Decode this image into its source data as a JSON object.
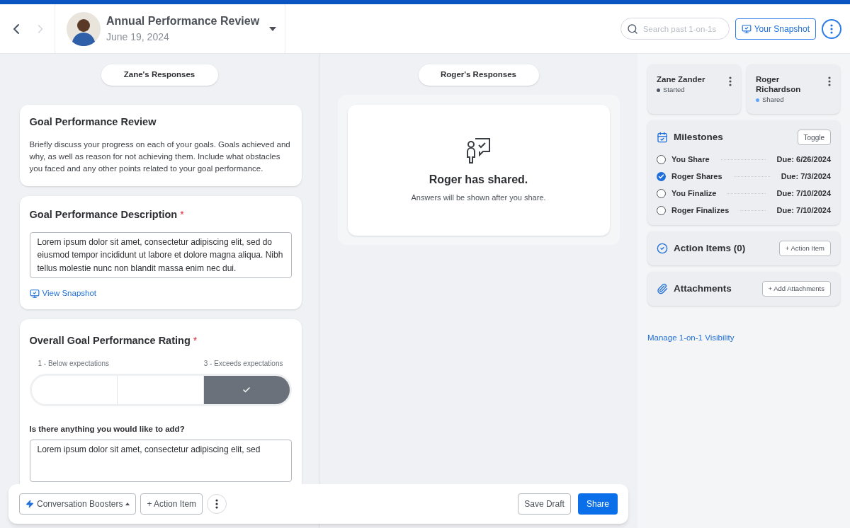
{
  "header": {
    "title": "Annual Performance Review",
    "date": "June 19, 2024",
    "search": {
      "placeholder": "Search past 1-on-1s"
    },
    "snapshot_button": "Your Snapshot"
  },
  "left": {
    "tab": "Zane's Responses",
    "intro": {
      "title": "Goal Performance Review",
      "text": "Briefly discuss your progress on each of your goals. Goals achieved and why, as well as reason for not achieving them. Include what obstacles you faced and any other points related to your goal performance."
    },
    "description": {
      "title": "Goal Performance Description",
      "required_mark": "*",
      "answer": "Lorem ipsum dolor sit amet, consectetur adipiscing elit, sed do eiusmod tempor incididunt ut labore et dolore magna aliqua. Nibh tellus molestie nunc non blandit massa enim nec dui.",
      "link": "View Snapshot"
    },
    "rating": {
      "title": "Overall Goal Performance Rating",
      "required_mark": "*",
      "low_label": "1 - Below expectations",
      "high_label": "3 - Exceeds expectations",
      "segments": [
        {
          "selected": false
        },
        {
          "selected": false
        },
        {
          "selected": true
        }
      ],
      "follow_up": {
        "label": "Is there anything you would like to add?",
        "answer": "Lorem ipsum dolor sit amet, consectetur adipiscing elit, sed"
      }
    }
  },
  "right": {
    "tab": "Roger's Responses",
    "message": {
      "title": "Roger has shared.",
      "subtitle": "Answers will be shown after you share."
    }
  },
  "sidebar": {
    "participants": [
      {
        "name": "Zane Zander",
        "status": "Started",
        "color": "#4b5563"
      },
      {
        "name": "Roger Richardson",
        "status": "Shared",
        "color": "#60a5fa"
      }
    ],
    "milestones": {
      "title": "Milestones",
      "button": "Toggle",
      "items": [
        {
          "label": "You Share",
          "due": "Due: 6/26/2024",
          "checked": false
        },
        {
          "label": "Roger Shares",
          "due": "Due: 7/3/2024",
          "checked": true
        },
        {
          "label": "You Finalize",
          "due": "Due: 7/10/2024",
          "checked": false
        },
        {
          "label": "Roger Finalizes",
          "due": "Due: 7/10/2024",
          "checked": false
        }
      ]
    },
    "action_items": {
      "title": "Action Items (0)",
      "button": "+ Action Item"
    },
    "attachments": {
      "title": "Attachments",
      "button": "+ Add Attachments"
    },
    "link": "Manage 1-on-1 Visibility"
  },
  "footer": {
    "boosters": "Conversation Boosters",
    "action_item": "+ Action Item",
    "save": "Save Draft",
    "share": "Share"
  }
}
